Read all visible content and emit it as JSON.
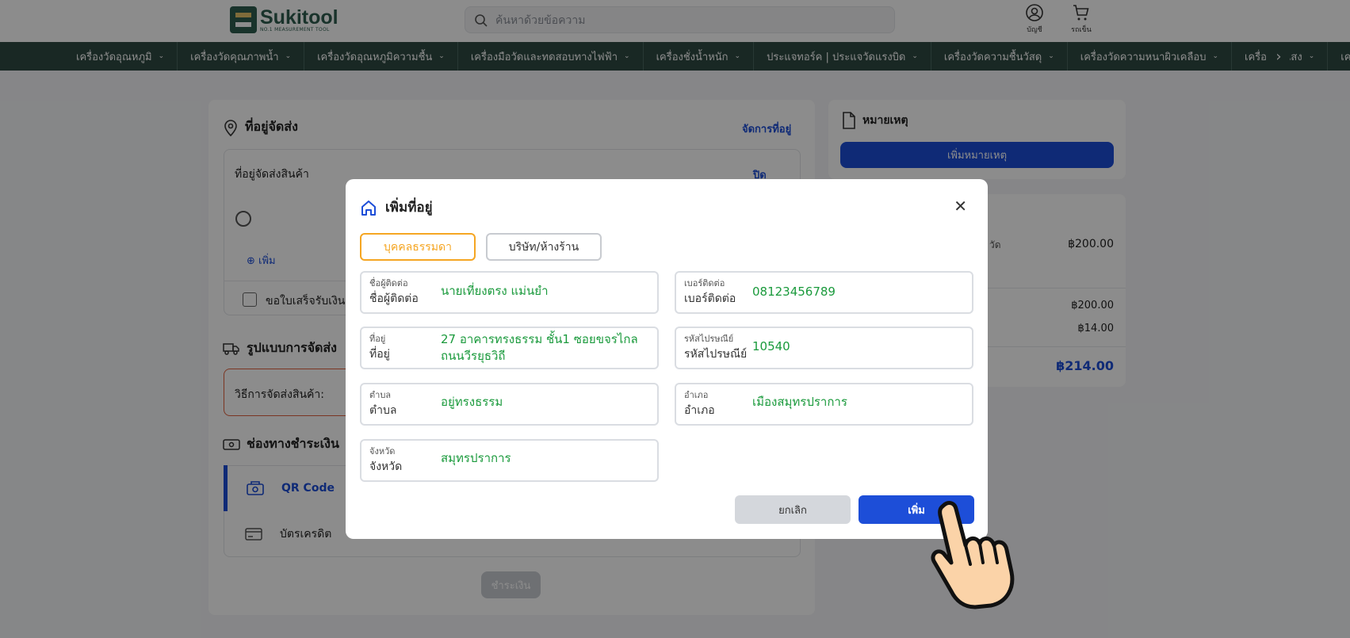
{
  "header": {
    "logo_name": "Sukitool",
    "logo_tagline": "NO.1 MEASUREMENT TOOL",
    "search_placeholder": "ค้นหาด้วยข้อความ",
    "account_label": "บัญชี",
    "cart_label": "รถเข็น"
  },
  "nav": {
    "items": [
      "เครื่องวัดอุณหภูมิ",
      "เครื่องวัดคุณภาพน้ำ",
      "เครื่องวัดอุณหภูมิความชื้น",
      "เครื่องมือวัดและทดสอบทางไฟฟ้า",
      "เครื่องชั่งน้ำหนัก",
      "ประแจทอร์ค | ประแจวัดแรงบิด",
      "เครื่องวัดความชื้นวัสดุ",
      "เครื่องวัดความหนาผิวเคลือบ",
      "เครื่องวัดแสง",
      "เครื่อง"
    ]
  },
  "shipping": {
    "title": "ที่อยู่จัดส่ง",
    "manage_link": "จัดการที่อยู่",
    "box_label": "ที่อยู่จัดส่งสินค้า",
    "close_link": "ปิด",
    "add_link": "เพิ่ม",
    "invoice_label": "ขอใบเสร็จรับเงิน"
  },
  "delivery": {
    "title": "รูปแบบการจัดส่ง",
    "method_label": "วิธีการจัดส่งสินค้า:"
  },
  "payment": {
    "title": "ช่องทางชำระเงิน",
    "options": [
      "QR Code",
      "บัตรเครดิต"
    ],
    "pay_button": "ชำระเงิน"
  },
  "note": {
    "title": "หมายเหตุ",
    "add_button": "เพิ่มหมายเหตุ"
  },
  "summary": {
    "partial_label": "วัด",
    "values": [
      "฿200.00",
      "฿200.00",
      "฿14.00"
    ],
    "total": "฿214.00"
  },
  "modal": {
    "title": "เพิ่มที่อยู่",
    "tab_person": "บุคคลธรรมดา",
    "tab_company": "บริษัท/ห้างร้าน",
    "fields": {
      "contact_name": {
        "label": "ชื่อผู้ติดต่อ",
        "value": "นายเที่ยงตรง  แม่นยำ"
      },
      "phone": {
        "label": "เบอร์ติดต่อ",
        "value": "08123456789"
      },
      "address": {
        "label": "ที่อยู่",
        "value": "27 อาคารทรงธรรม ชั้น1 ซอยขจรไกล ถนนวีรยุธวิถี"
      },
      "postcode": {
        "label": "รหัสไปรษณีย์",
        "value": "10540"
      },
      "subdistrict": {
        "label": "ตำบล",
        "value": "อยู่ทรงธรรม"
      },
      "district": {
        "label": "อำเภอ",
        "value": "เมืองสมุทรปราการ"
      },
      "province": {
        "label": "จังหวัด",
        "value": "สมุทรปราการ"
      }
    },
    "cancel_button": "ยกเลิก",
    "add_button": "เพิ่ม"
  },
  "colors": {
    "brand_green": "#2f4a43",
    "primary_blue": "#1d4ed8",
    "accent_orange": "#f5a623",
    "value_green": "#1a9a3c"
  }
}
